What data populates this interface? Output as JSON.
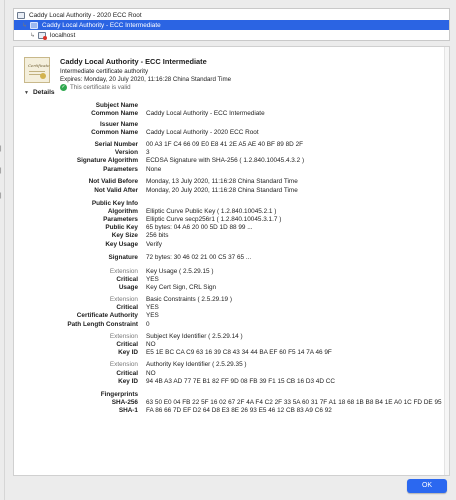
{
  "chain": [
    {
      "label": "Caddy Local Authority - 2020 ECC Root"
    },
    {
      "label": "Caddy Local Authority - ECC Intermediate"
    },
    {
      "label": "localhost"
    }
  ],
  "header": {
    "name": "Caddy Local Authority - ECC Intermediate",
    "kind": "Intermediate certificate authority",
    "expires": "Expires: Monday, 20 July 2020, 11:16:28 China Standard Time",
    "status": "This certificate is valid",
    "certificate_image_label": "Certificate"
  },
  "details_label": "Details",
  "rows": [
    {
      "k": "Subject Name",
      "v": ""
    },
    {
      "k": "Common Name",
      "v": "Caddy Local Authority - ECC Intermediate"
    },
    {
      "k": "Issuer Name",
      "v": ""
    },
    {
      "k": "Common Name",
      "v": "Caddy Local Authority - 2020 ECC Root"
    },
    {
      "k": "Serial Number",
      "v": "00 A3 1F C4 66 09 E0 E8 41 2E A5 AE 40 BF 89 8D 2F"
    },
    {
      "k": "Version",
      "v": "3"
    },
    {
      "k": "Signature Algorithm",
      "v": "ECDSA Signature with SHA-256 ( 1.2.840.10045.4.3.2 )"
    },
    {
      "k": "Parameters",
      "v": "None"
    },
    {
      "k": "Not Valid Before",
      "v": "Monday, 13 July 2020, 11:16:28 China Standard Time"
    },
    {
      "k": "Not Valid After",
      "v": "Monday, 20 July 2020, 11:16:28 China Standard Time"
    },
    {
      "k": "Public Key Info",
      "v": ""
    },
    {
      "k": "Algorithm",
      "v": "Elliptic Curve Public Key ( 1.2.840.10045.2.1 )"
    },
    {
      "k": "Parameters",
      "v": "Elliptic Curve secp256r1 ( 1.2.840.10045.3.1.7 )"
    },
    {
      "k": "Public Key",
      "v": "65 bytes: 04 A6 20 00 5D 1D 88 99 ..."
    },
    {
      "k": "Key Size",
      "v": "256 bits"
    },
    {
      "k": "Key Usage",
      "v": "Verify"
    },
    {
      "k": "Signature",
      "v": "72 bytes: 30 46 02 21 00 C5 37 65 ..."
    },
    {
      "k": "Extension",
      "v": "Key Usage ( 2.5.29.15 )",
      "light": true
    },
    {
      "k": "Critical",
      "v": "YES"
    },
    {
      "k": "Usage",
      "v": "Key Cert Sign, CRL Sign"
    },
    {
      "k": "Extension",
      "v": "Basic Constraints ( 2.5.29.19 )",
      "light": true
    },
    {
      "k": "Critical",
      "v": "YES"
    },
    {
      "k": "Certificate Authority",
      "v": "YES"
    },
    {
      "k": "Path Length Constraint",
      "v": "0"
    },
    {
      "k": "Extension",
      "v": "Subject Key Identifier ( 2.5.29.14 )",
      "light": true
    },
    {
      "k": "Critical",
      "v": "NO"
    },
    {
      "k": "Key ID",
      "v": "E5 1E BC CA C9 63 16 39 C8 43 34 44 BA EF 60 F5 14 7A 46 9F"
    },
    {
      "k": "Extension",
      "v": "Authority Key Identifier ( 2.5.29.35 )",
      "light": true
    },
    {
      "k": "Critical",
      "v": "NO"
    },
    {
      "k": "Key ID",
      "v": "94 4B A3 AD 77 7E B1 82 FF 9D 08 FB 39 F1 15 CB 16 D3 4D CC"
    },
    {
      "k": "Fingerprints",
      "v": ""
    },
    {
      "k": "SHA-256",
      "v": "63 50 E0 04 FB 22 5F 16 02 67 2F 4A F4 C2 2F 33 5A 60 31 7F A1 18 68 1B B8 B4 1E A0 1C FD DE 95"
    },
    {
      "k": "SHA-1",
      "v": "FA 86 66 7D EF D2 64 D8 E3 8E 26 93 E5 46 12 CB 83 A9 C6 92"
    }
  ],
  "ok_label": "OK",
  "left_edge_glyphs": [
    "|",
    "|",
    "|"
  ],
  "colors": {
    "selection": "#2b64e3",
    "ok_button": "#2b68f0",
    "valid": "#2fa84f"
  }
}
